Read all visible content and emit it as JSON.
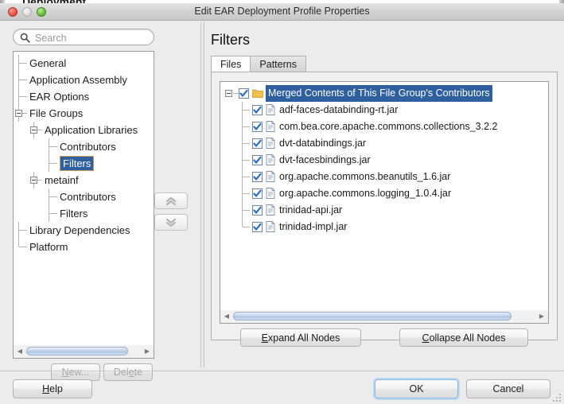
{
  "background_window": {
    "title": "Deployment"
  },
  "dialog": {
    "title": "Edit EAR Deployment Profile Properties",
    "window_controls": {
      "close": "close-button",
      "minimize": "minimize-button",
      "maximize": "maximize-button"
    }
  },
  "search": {
    "value": "",
    "placeholder": "Search",
    "icon": "search-icon"
  },
  "sidebar": {
    "tree": [
      {
        "label": "General",
        "depth": 0,
        "toggle": "none"
      },
      {
        "label": "Application Assembly",
        "depth": 0,
        "toggle": "none"
      },
      {
        "label": "EAR Options",
        "depth": 0,
        "toggle": "none"
      },
      {
        "label": "File Groups",
        "depth": 0,
        "toggle": "expanded"
      },
      {
        "label": "Application Libraries",
        "depth": 1,
        "toggle": "expanded"
      },
      {
        "label": "Contributors",
        "depth": 2,
        "toggle": "none"
      },
      {
        "label": "Filters",
        "depth": 2,
        "toggle": "none",
        "selected": true
      },
      {
        "label": "metainf",
        "depth": 1,
        "toggle": "expanded"
      },
      {
        "label": "Contributors",
        "depth": 2,
        "toggle": "none"
      },
      {
        "label": "Filters",
        "depth": 2,
        "toggle": "none"
      },
      {
        "label": "Library Dependencies",
        "depth": 0,
        "toggle": "none"
      },
      {
        "label": "Platform",
        "depth": 0,
        "toggle": "none"
      }
    ],
    "move_up_button": {
      "icon": "chevron-double-up-icon",
      "enabled": false
    },
    "move_down_button": {
      "icon": "chevron-double-down-icon",
      "enabled": false
    },
    "new_button": {
      "label": "New...",
      "mnemonic": "N",
      "enabled": false
    },
    "delete_button": {
      "label": "Delete",
      "mnemonic": "e",
      "enabled": false
    }
  },
  "main": {
    "title": "Filters",
    "tabs": [
      {
        "label": "Files",
        "active": true
      },
      {
        "label": "Patterns",
        "active": false
      }
    ],
    "file_tree": {
      "root": {
        "label": "Merged Contents of This File Group's Contributors",
        "checked": true,
        "selected": true,
        "expanded": true,
        "icon": "folder-icon"
      },
      "children": [
        {
          "label": "adf-faces-databinding-rt.jar",
          "checked": true,
          "icon": "document-icon"
        },
        {
          "label": "com.bea.core.apache.commons.collections_3.2.2",
          "checked": true,
          "icon": "document-icon",
          "truncated": true
        },
        {
          "label": "dvt-databindings.jar",
          "checked": true,
          "icon": "document-icon"
        },
        {
          "label": "dvt-facesbindings.jar",
          "checked": true,
          "icon": "document-icon"
        },
        {
          "label": "org.apache.commons.beanutils_1.6.jar",
          "checked": true,
          "icon": "document-icon"
        },
        {
          "label": "org.apache.commons.logging_1.0.4.jar",
          "checked": true,
          "icon": "document-icon"
        },
        {
          "label": "trinidad-api.jar",
          "checked": true,
          "icon": "document-icon"
        },
        {
          "label": "trinidad-impl.jar",
          "checked": true,
          "icon": "document-icon"
        }
      ]
    },
    "expand_button": {
      "label": "Expand All Nodes",
      "mnemonic": "E"
    },
    "collapse_button": {
      "label": "Collapse All Nodes",
      "mnemonic": "C"
    }
  },
  "footer": {
    "help_button": {
      "label": "Help",
      "mnemonic": "H"
    },
    "ok_button": {
      "label": "OK",
      "focused": true
    },
    "cancel_button": {
      "label": "Cancel"
    }
  },
  "colors": {
    "selection_blue": "#2e5f9e",
    "focus_border_orange": "#d09a5a",
    "focus_ring_blue": "#bcd9f2",
    "checkbox_blue": "#2f6fc0",
    "folder_yellow": "#f0c24b",
    "dialog_background": "#ececec",
    "list_background": "#ffffff"
  }
}
